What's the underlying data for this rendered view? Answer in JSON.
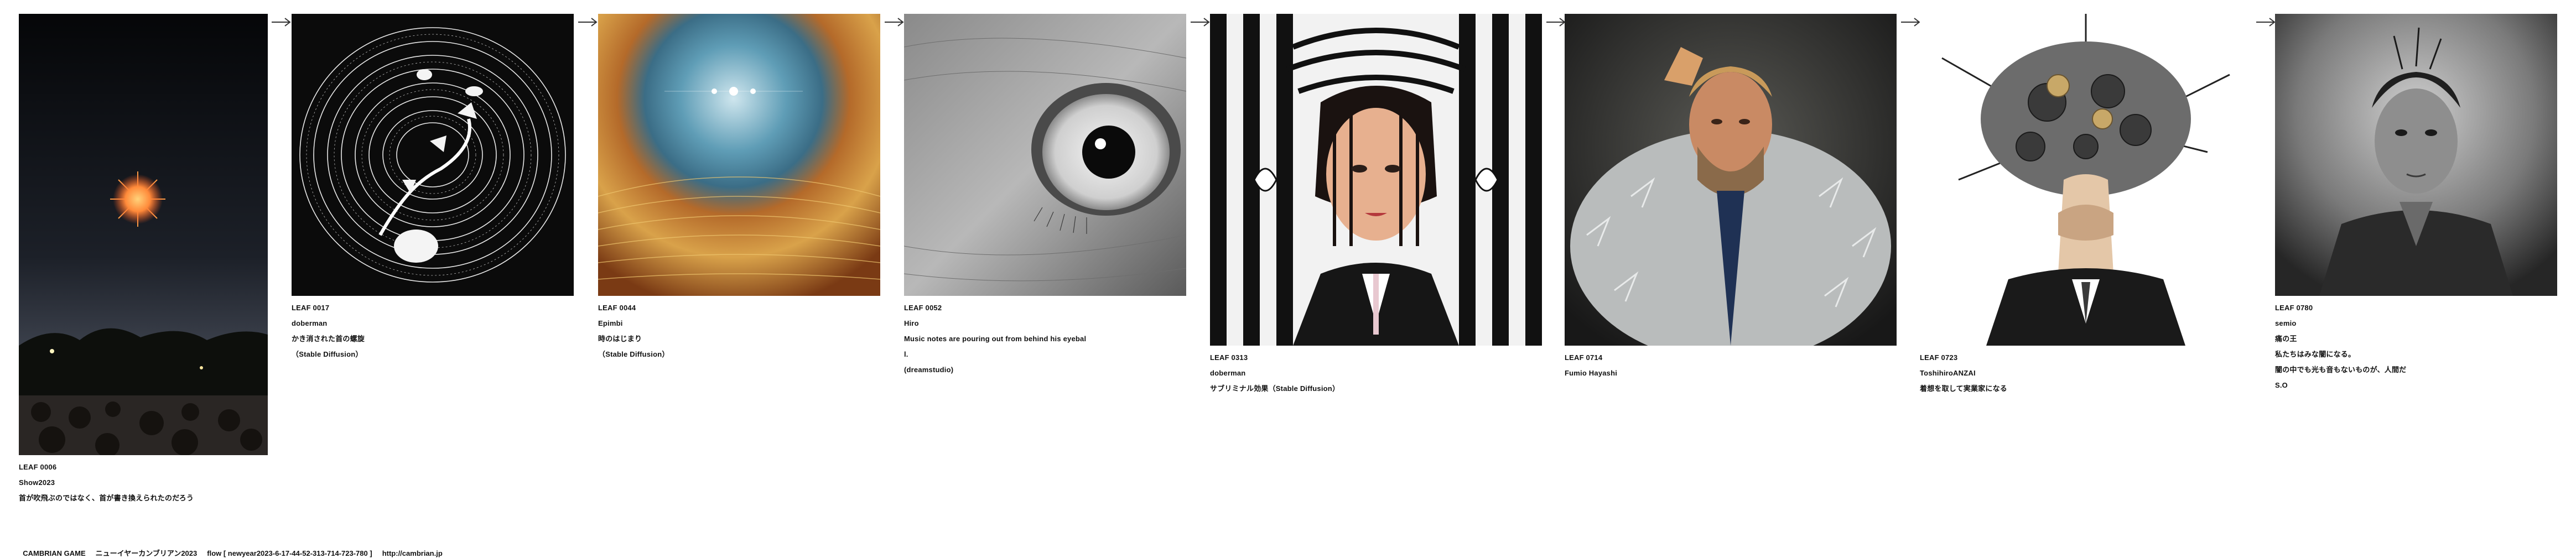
{
  "leaves": [
    {
      "id": "LEAF 0006",
      "author": "Show2023",
      "text": [
        "首が吹飛ぶのではなく、首が書き換えられたのだろう"
      ]
    },
    {
      "id": "LEAF 0017",
      "author": "doberman",
      "text": [
        "かき消された首の螺旋",
        "（Stable Diffusion）"
      ]
    },
    {
      "id": "LEAF 0044",
      "author": "Epimbi",
      "text": [
        "時のはじまり",
        "（Stable Diffusion）"
      ]
    },
    {
      "id": "LEAF 0052",
      "author": "Hiro",
      "text": [
        "Music notes are pouring out from behind his eyebal",
        "l.",
        "(dreamstudio)"
      ]
    },
    {
      "id": "LEAF 0313",
      "author": "doberman",
      "text": [
        "サブリミナル効果（Stable Diffusion）"
      ]
    },
    {
      "id": "LEAF 0714",
      "author": "Fumio Hayashi",
      "text": []
    },
    {
      "id": "LEAF 0723",
      "author": "ToshihiroANZAI",
      "text": [
        "着想を取して実業家になる"
      ]
    },
    {
      "id": "LEAF 0780",
      "author": "semio",
      "text": [
        "痛の王",
        "私たちはみな闇になる。",
        "闇の中でも光も音もないものが、人間だ",
        "S.O"
      ]
    }
  ],
  "footer": {
    "game": "CAMBRIAN GAME",
    "title": "ニューイヤーカンブリアン2023",
    "flow": "flow [ newyear2023-6-17-44-52-313-714-723-780 ]",
    "url": "http://cambrian.jp"
  },
  "images": [
    "fireworks-night-crowd-photo",
    "spiral-ink-abstract-image",
    "cosmic-eye-sunset-image",
    "monochrome-eye-closeup-image",
    "striped-portrait-woman-image",
    "bearded-man-feathers-image",
    "mechanical-gear-head-image",
    "bw-boy-portrait-image"
  ],
  "colors": {
    "background": "#ffffff",
    "text": "#111111"
  }
}
